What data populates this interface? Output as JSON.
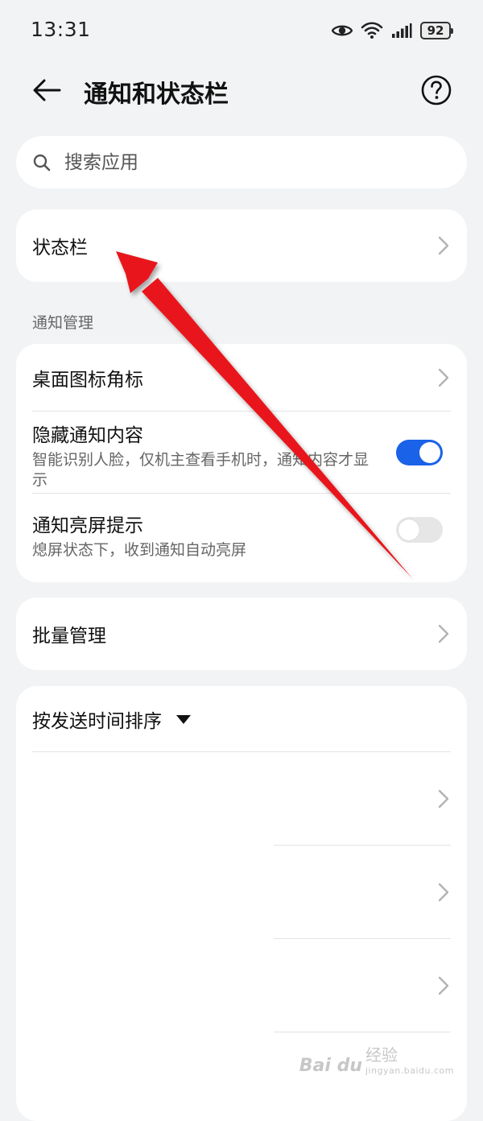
{
  "status_bar": {
    "time": "13:31",
    "battery": "92",
    "icons": [
      "eye-icon",
      "wifi-icon",
      "signal-icon",
      "battery-icon"
    ]
  },
  "header": {
    "title": "通知和状态栏",
    "back_icon": "back-arrow-icon",
    "help_icon": "help-icon"
  },
  "search": {
    "placeholder": "搜索应用",
    "icon": "search-icon"
  },
  "status_bar_row": {
    "title": "状态栏"
  },
  "notification_section": {
    "label": "通知管理",
    "items": [
      {
        "title": "桌面图标角标",
        "type": "link"
      },
      {
        "title": "隐藏通知内容",
        "subtitle": "智能识别人脸，仅机主查看手机时，通知内容才显示",
        "type": "toggle",
        "on": true
      },
      {
        "title": "通知亮屏提示",
        "subtitle": "熄屏状态下，收到通知自动亮屏",
        "type": "toggle",
        "on": false
      }
    ]
  },
  "batch_row": {
    "title": "批量管理"
  },
  "sort_card": {
    "title": "按发送时间排序"
  },
  "colors": {
    "background": "#f1f3f5",
    "card": "#ffffff",
    "accent": "#1a62e8",
    "arrow_annotation": "#e8191c"
  },
  "watermark": {
    "logo": "Bai du",
    "brand": "经验",
    "url": "jingyan.baidu.com"
  }
}
